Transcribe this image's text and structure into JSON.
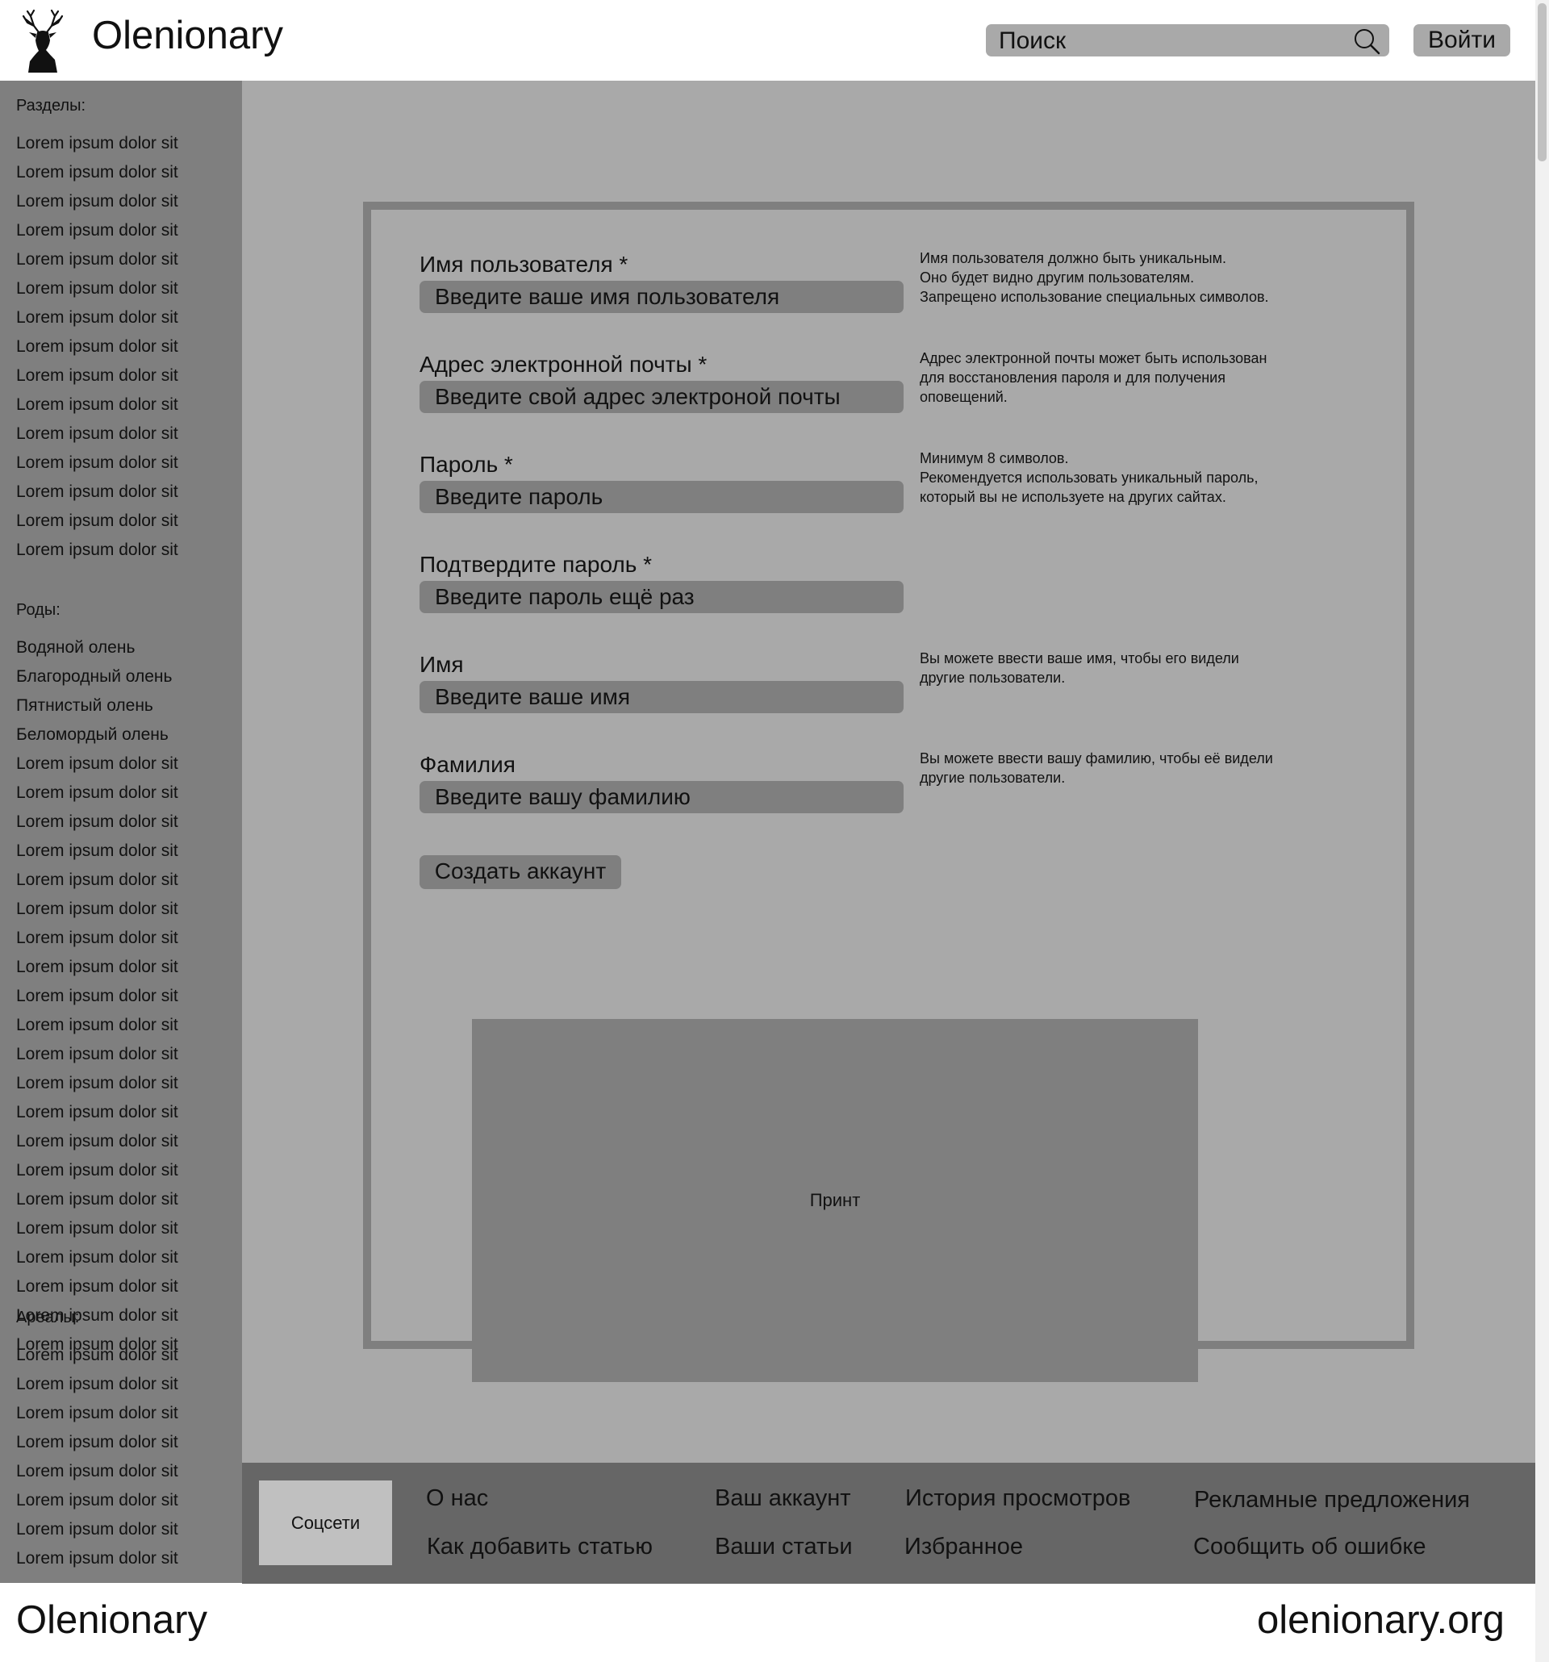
{
  "header": {
    "site_title": "Olenionary",
    "search_placeholder": "Поиск",
    "login_label": "Войти"
  },
  "sidebar": {
    "sections": [
      {
        "heading": "Разделы:",
        "items": [
          "Lorem ipsum dolor sit",
          "Lorem ipsum dolor sit",
          "Lorem ipsum dolor sit",
          "Lorem ipsum dolor sit",
          "Lorem ipsum dolor sit",
          "Lorem ipsum dolor sit",
          "Lorem ipsum dolor sit",
          "Lorem ipsum dolor sit",
          "Lorem ipsum dolor sit",
          "Lorem ipsum dolor sit",
          "Lorem ipsum dolor sit",
          "Lorem ipsum dolor sit",
          "Lorem ipsum dolor sit",
          "Lorem ipsum dolor sit",
          "Lorem ipsum dolor sit"
        ]
      },
      {
        "heading": "Роды:",
        "items": [
          "Водяной олень",
          "Благородный олень",
          "Пятнистый олень",
          "Беломордый олень",
          "Lorem ipsum dolor sit",
          "Lorem ipsum dolor sit",
          "Lorem ipsum dolor sit",
          "Lorem ipsum dolor sit",
          "Lorem ipsum dolor sit",
          "Lorem ipsum dolor sit",
          "Lorem ipsum dolor sit",
          "Lorem ipsum dolor sit",
          "Lorem ipsum dolor sit",
          "Lorem ipsum dolor sit",
          "Lorem ipsum dolor sit",
          "Lorem ipsum dolor sit",
          "Lorem ipsum dolor sit",
          "Lorem ipsum dolor sit",
          "Lorem ipsum dolor sit",
          "Lorem ipsum dolor sit",
          "Lorem ipsum dolor sit",
          "Lorem ipsum dolor sit",
          "Lorem ipsum dolor sit",
          "Lorem ipsum dolor sit",
          "Lorem ipsum dolor sit"
        ]
      },
      {
        "heading": "Ареалы:",
        "items": [
          "Lorem ipsum dolor sit",
          "Lorem ipsum dolor sit",
          "Lorem ipsum dolor sit",
          "Lorem ipsum dolor sit",
          "Lorem ipsum dolor sit",
          "Lorem ipsum dolor sit",
          "Lorem ipsum dolor sit",
          "Lorem ipsum dolor sit"
        ]
      }
    ]
  },
  "form": {
    "fields": [
      {
        "label": "Имя пользователя *",
        "placeholder": "Введите ваше имя пользователя",
        "hint": [
          "Имя пользователя должно быть уникальным.",
          "Оно будет видно другим пользователям.",
          "Запрещено использование специальных символов."
        ]
      },
      {
        "label": "Адрес электронной почты *",
        "placeholder": "Введите свой адрес электроной почты",
        "hint": [
          "Адрес электронной почты может быть использован",
          "для восстановления пароля и для получения",
          "оповещений."
        ]
      },
      {
        "label": "Пароль *",
        "placeholder": "Введите пароль",
        "hint": [
          "Минимум 8 символов.",
          "Рекомендуется использовать уникальный пароль,",
          "который вы не используете на других сайтах."
        ]
      },
      {
        "label": "Подтвердите пароль *",
        "placeholder": "Введите пароль ещё раз",
        "hint": []
      },
      {
        "label": "Имя",
        "placeholder": "Введите ваше имя",
        "hint": [
          "Вы можете ввести ваше имя, чтобы его видели",
          "другие пользователи."
        ]
      },
      {
        "label": "Фамилия",
        "placeholder": "Введите вашу фамилию",
        "hint": [
          "Вы можете ввести вашу фамилию, чтобы её видели",
          "другие пользователи."
        ]
      }
    ],
    "submit_label": "Создать аккаунт",
    "print_label": "Принт"
  },
  "footer": {
    "socials_label": "Соцсети",
    "links": [
      {
        "id": "about",
        "label": "О нас"
      },
      {
        "id": "how-to-add-article",
        "label": "Как добавить статью"
      },
      {
        "id": "your-account",
        "label": "Ваш аккаунт"
      },
      {
        "id": "your-articles",
        "label": "Ваши статьи"
      },
      {
        "id": "history",
        "label": "История просмотров"
      },
      {
        "id": "favorites",
        "label": "Избранное"
      },
      {
        "id": "ads",
        "label": "Рекламные предложения"
      },
      {
        "id": "report-error",
        "label": "Сообщить об ошибке"
      }
    ]
  },
  "bottom": {
    "brand": "Olenionary",
    "domain": "olenionary.org"
  },
  "colors": {
    "sidebar_bg": "#7f7f7f",
    "main_bg": "#a9a9a9",
    "footer_bg": "#666666",
    "input_bg": "#7f7f7f",
    "socials_bg": "#c0c0c0"
  }
}
